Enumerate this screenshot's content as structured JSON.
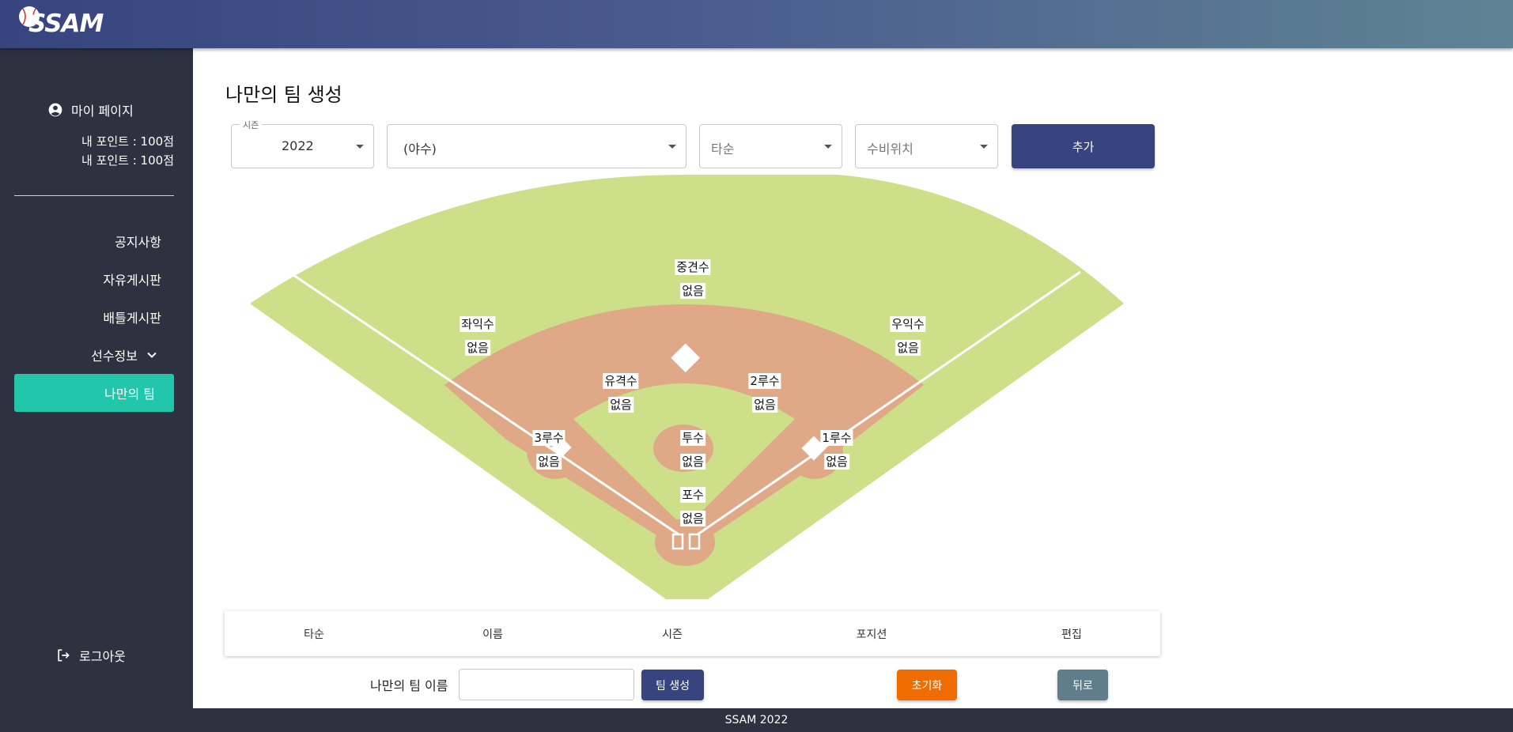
{
  "header": {
    "logo_text": "SSAM"
  },
  "sidebar": {
    "mypage_label": "마이 페이지",
    "points": [
      "내 포인트 : 100점",
      "내 포인트 : 100점"
    ],
    "nav": {
      "notice": "공지사항",
      "free_board": "자유게시판",
      "battle_board": "배틀게시판",
      "player_info": "선수정보",
      "my_team": "나만의 팀"
    },
    "logout_label": "로그아웃"
  },
  "main": {
    "title": "나만의 팀 생성",
    "season": {
      "legend": "시즌",
      "value": "2022"
    },
    "player_select": {
      "value": "(야수)"
    },
    "batting_order": {
      "placeholder": "타순"
    },
    "position_select": {
      "placeholder": "수비위치"
    },
    "add_button": "추가",
    "positions": {
      "cf": {
        "name": "중견수",
        "player": "없음"
      },
      "lf": {
        "name": "좌익수",
        "player": "없음"
      },
      "rf": {
        "name": "우익수",
        "player": "없음"
      },
      "ss": {
        "name": "유격수",
        "player": "없음"
      },
      "2b": {
        "name": "2루수",
        "player": "없음"
      },
      "3b": {
        "name": "3루수",
        "player": "없음"
      },
      "p": {
        "name": "투수",
        "player": "없음"
      },
      "1b": {
        "name": "1루수",
        "player": "없음"
      },
      "c": {
        "name": "포수",
        "player": "없음"
      }
    },
    "table_headers": [
      "타순",
      "이름",
      "시즌",
      "포지션",
      "편집"
    ],
    "team_name_label": "나만의 팀 이름",
    "team_name_value": "",
    "create_button": "팀 생성",
    "reset_button": "초기화",
    "back_button": "뒤로"
  },
  "footer": {
    "text": "SSAM 2022"
  },
  "colors": {
    "header_start": "#37447f",
    "header_end": "#5e8494",
    "sidebar": "#2c323f",
    "active_nav": "#22c7ab",
    "grass": "#cddf88",
    "infield_dirt": "#dfa987",
    "primary_button": "#37447f",
    "reset_button": "#ef6c00",
    "back_button": "#607d8b"
  },
  "icons": {
    "mypage": "account-circle-icon",
    "dropdown": "chevron-down-icon",
    "logout": "logout-icon",
    "select_caret": "caret-down-icon"
  }
}
